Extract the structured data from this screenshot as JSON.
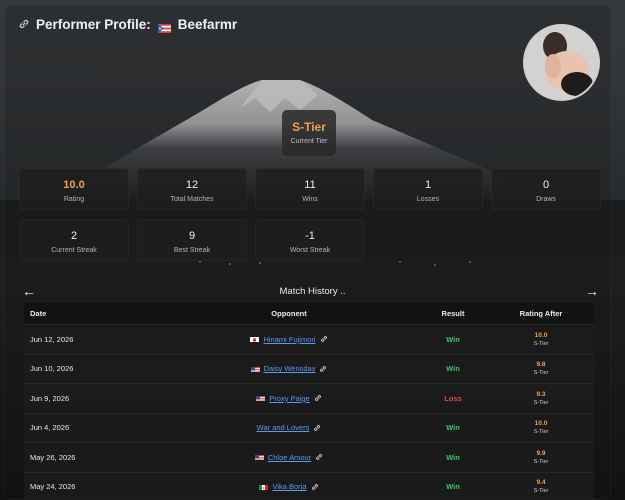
{
  "header": {
    "title_prefix": "Performer Profile:",
    "performer_name": "Beefarmr"
  },
  "tier": {
    "name": "S-Tier",
    "label": "Current Tier"
  },
  "stats": [
    {
      "value": "10.0",
      "label": "Rating"
    },
    {
      "value": "12",
      "label": "Total Matches"
    },
    {
      "value": "11",
      "label": "Wins"
    },
    {
      "value": "1",
      "label": "Losses"
    },
    {
      "value": "0",
      "label": "Draws"
    },
    {
      "value": "2",
      "label": "Current Streak"
    },
    {
      "value": "9",
      "label": "Best Streak"
    },
    {
      "value": "-1",
      "label": "Worst Streak"
    }
  ],
  "history": {
    "title": "Match History ..",
    "prev_label": "←",
    "next_label": "→",
    "columns": [
      "Date",
      "Opponent",
      "Result",
      "Rating After"
    ],
    "rows": [
      {
        "date": "Jun 12, 2026",
        "opponent": "Hinami Fujimori",
        "flag": "jp",
        "result": "Win",
        "rating": "10.0",
        "tier": "S-Tier"
      },
      {
        "date": "Jun 10, 2026",
        "opponent": "Daisy Wensday",
        "flag": "us",
        "result": "Win",
        "rating": "9.8",
        "tier": "S-Tier"
      },
      {
        "date": "Jun 9, 2026",
        "opponent": "Proxy Paige",
        "flag": "us",
        "result": "Loss",
        "rating": "9.3",
        "tier": "S-Tier"
      },
      {
        "date": "Jun 4, 2026",
        "opponent": "War and Lovers",
        "flag": "",
        "result": "Win",
        "rating": "10.0",
        "tier": "S-Tier"
      },
      {
        "date": "May 26, 2026",
        "opponent": "Chloe Amour",
        "flag": "us",
        "result": "Win",
        "rating": "9.9",
        "tier": "S-Tier"
      },
      {
        "date": "May 24, 2026",
        "opponent": "Vika Borja",
        "flag": "mx",
        "result": "Win",
        "rating": "9.4",
        "tier": "S-Tier"
      }
    ]
  },
  "colors": {
    "accent": "#f0a050",
    "win": "#3cc46a",
    "loss": "#e24848",
    "link": "#5b9bef"
  }
}
